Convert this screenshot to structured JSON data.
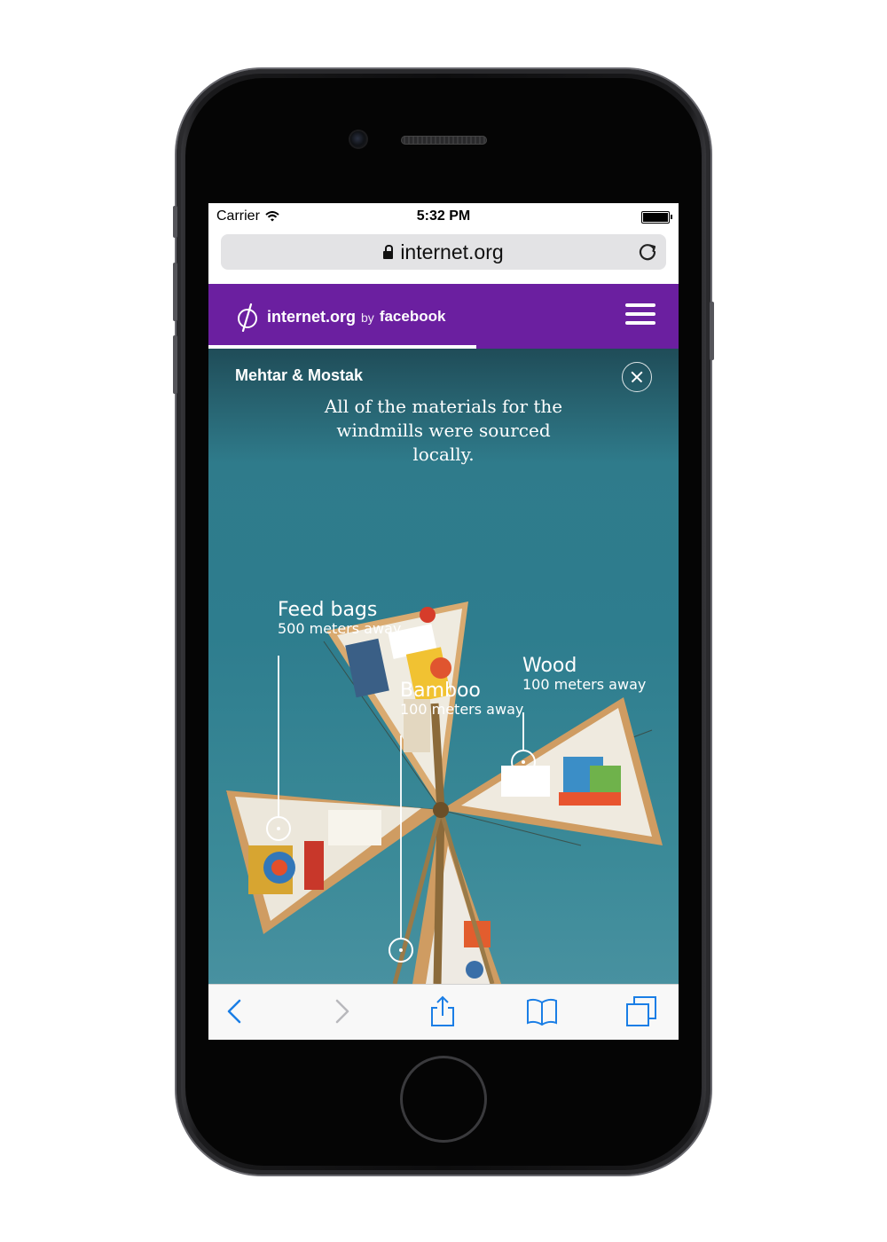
{
  "status_bar": {
    "carrier": "Carrier",
    "time": "5:32 PM"
  },
  "browser": {
    "url": "internet.org"
  },
  "site_header": {
    "brand_name": "internet.org",
    "brand_by": "by",
    "brand_partner": "facebook",
    "progress_fraction": 0.57,
    "background": "#6b1fa0"
  },
  "story": {
    "title": "Mehtar & Mostak",
    "headline": "All of the materials for the windmills were sourced locally."
  },
  "callouts": [
    {
      "name": "Feed bags",
      "distance": "500 meters away"
    },
    {
      "name": "Bamboo",
      "distance": "100 meters away"
    },
    {
      "name": "Wood",
      "distance": "100 meters away"
    }
  ],
  "toolbar": {
    "icons": [
      "back-icon",
      "forward-icon",
      "share-icon",
      "bookmarks-icon",
      "tabs-icon"
    ],
    "accent": "#1a7ee6"
  }
}
